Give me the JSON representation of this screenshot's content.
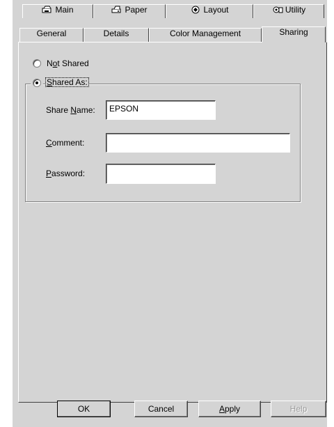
{
  "tabs_row1": [
    {
      "label": "Main",
      "icon": "main-tab-icon"
    },
    {
      "label": "Paper",
      "icon": "paper-tab-icon"
    },
    {
      "label": "Layout",
      "icon": "layout-tab-icon"
    },
    {
      "label": "Utility",
      "icon": "utility-tab-icon"
    }
  ],
  "tabs_row2": [
    {
      "label": "General"
    },
    {
      "label": "Details"
    },
    {
      "label": "Color Management"
    },
    {
      "label": "Sharing"
    }
  ],
  "sharing": {
    "not_shared_pre": "N",
    "not_shared_ul": "o",
    "not_shared_post": "t Shared",
    "shared_as_ul": "S",
    "shared_as_post": "hared As:",
    "selected": "shared_as",
    "share_name_pre": "Share ",
    "share_name_ul": "N",
    "share_name_post": "ame:",
    "share_name_value": "EPSON",
    "comment_ul": "C",
    "comment_post": "omment:",
    "comment_value": "",
    "password_ul": "P",
    "password_post": "assword:",
    "password_value": ""
  },
  "buttons": {
    "ok": "OK",
    "cancel": "Cancel",
    "apply_ul": "A",
    "apply_post": "pply",
    "help": "Help"
  },
  "colors": {
    "face": "#d4d4d4",
    "highlight": "#ffffff",
    "shadow": "#808080",
    "dark_shadow": "#404040"
  }
}
